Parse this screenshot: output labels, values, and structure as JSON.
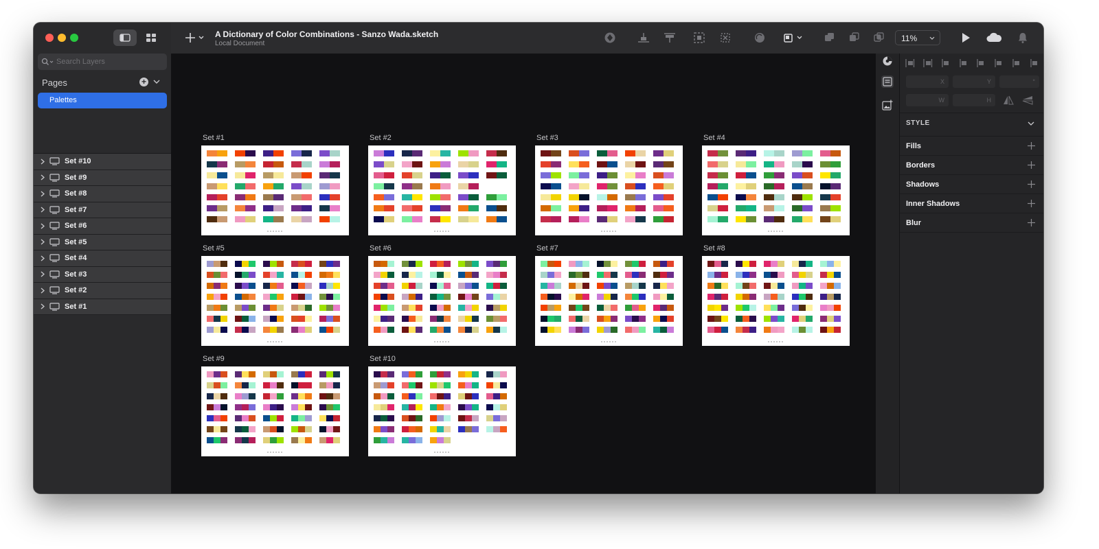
{
  "window": {
    "title": "A Dictionary of Color Combinations - Sanzo Wada.sketch",
    "subtitle": "Local Document",
    "zoom": "11%"
  },
  "sidebar": {
    "search_placeholder": "Search Layers",
    "pages_label": "Pages",
    "pages": [
      {
        "label": "Palettes",
        "selected": true
      }
    ],
    "layers": [
      {
        "label": "Set #10"
      },
      {
        "label": "Set #9"
      },
      {
        "label": "Set #8"
      },
      {
        "label": "Set #7"
      },
      {
        "label": "Set #6"
      },
      {
        "label": "Set #5"
      },
      {
        "label": "Set #4"
      },
      {
        "label": "Set #3"
      },
      {
        "label": "Set #2"
      },
      {
        "label": "Set #1"
      }
    ]
  },
  "canvas": {
    "artboards": [
      {
        "label": "Set #1"
      },
      {
        "label": "Set #2"
      },
      {
        "label": "Set #3"
      },
      {
        "label": "Set #4"
      },
      {
        "label": "Set #5"
      },
      {
        "label": "Set #6"
      },
      {
        "label": "Set #7"
      },
      {
        "label": "Set #8"
      },
      {
        "label": "Set #9"
      },
      {
        "label": "Set #10"
      }
    ],
    "swatch_colors": [
      "#e4412a",
      "#27b5a3",
      "#f07a14",
      "#17264a",
      "#c7590e",
      "#f6e99a",
      "#b89b64",
      "#3d1f86",
      "#2f9e3a",
      "#0a4f8e",
      "#e35c8d",
      "#05122b",
      "#f55e1e",
      "#9e9bd1",
      "#d94f1f",
      "#6d2d8a",
      "#7a6dd9",
      "#f2d400",
      "#6b8f34",
      "#a8d4c9",
      "#ead4a6",
      "#c52d4b",
      "#9a7a4e",
      "#14b586",
      "#d8d28c",
      "#5a2a75",
      "#7b4cc9",
      "#ffe05a",
      "#1ec86b",
      "#e97ec8",
      "#6e1313",
      "#b7f3e6",
      "#e0246b",
      "#23a96a",
      "#c8a5c2",
      "#2a0c4c",
      "#4f2c0e",
      "#9ee200",
      "#f8a20e",
      "#ca7bd8",
      "#f26b6b",
      "#ffe600",
      "#8f2f88",
      "#2c2fbe",
      "#f09ac1",
      "#0a5d3b",
      "#c52432",
      "#a5f3d3",
      "#f4853b",
      "#734419",
      "#f3a4c8",
      "#15374a",
      "#711616",
      "#e0d07a",
      "#72913b",
      "#8ab3e9",
      "#cf1f3e",
      "#8a2c74",
      "#f24100",
      "#fdf1a0",
      "#c99a72",
      "#7cf0a0",
      "#2a6a28",
      "#0b0b4e",
      "#b51f5a",
      "#d46a00"
    ]
  },
  "inspector": {
    "fields": {
      "x": "X",
      "y": "Y",
      "rotation": "°",
      "w": "W",
      "h": "H"
    },
    "style_header": "STYLE",
    "properties": [
      {
        "label": "Fills"
      },
      {
        "label": "Borders"
      },
      {
        "label": "Shadows"
      },
      {
        "label": "Inner Shadows"
      },
      {
        "label": "Blur"
      }
    ]
  }
}
